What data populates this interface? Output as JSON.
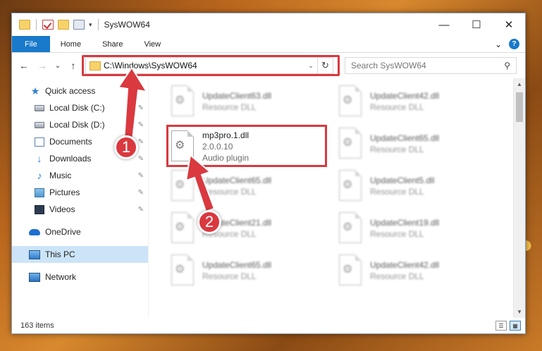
{
  "window": {
    "title": "SysWOW64",
    "controls": {
      "minimize": "—",
      "maximize": "☐",
      "close": "✕"
    }
  },
  "ribbon": {
    "tabs": [
      "File",
      "Home",
      "Share",
      "View"
    ],
    "expand_icon": "⌄",
    "help_icon": "?"
  },
  "nav": {
    "back": "←",
    "forward": "→",
    "recent": "⌄",
    "up": "↑",
    "address": "C:\\Windows\\SysWOW64",
    "address_dropdown": "⌄",
    "refresh": "↻",
    "search_placeholder": "Search SysWOW64",
    "search_icon": "⚲"
  },
  "sidebar": {
    "items": [
      {
        "label": "Quick access",
        "icon": "star-icon"
      },
      {
        "label": "Local Disk (C:)",
        "icon": "disk-icon",
        "pinned": true
      },
      {
        "label": "Local Disk (D:)",
        "icon": "disk-icon",
        "pinned": true
      },
      {
        "label": "Documents",
        "icon": "documents-icon",
        "pinned": true
      },
      {
        "label": "Downloads",
        "icon": "downloads-icon",
        "pinned": true
      },
      {
        "label": "Music",
        "icon": "music-icon",
        "pinned": true
      },
      {
        "label": "Pictures",
        "icon": "pictures-icon",
        "pinned": true
      },
      {
        "label": "Videos",
        "icon": "videos-icon",
        "pinned": true
      },
      {
        "label": "OneDrive",
        "icon": "onedrive-icon"
      },
      {
        "label": "This PC",
        "icon": "this-pc-icon",
        "selected": true
      },
      {
        "label": "Network",
        "icon": "network-icon"
      }
    ],
    "pin_glyph": "📌"
  },
  "files": {
    "left_column": [
      {
        "name": "UpdateClient63.dll",
        "type": "Resource DLL"
      },
      {
        "name": "mp3pro.1.dll",
        "version": "2.0.0.10",
        "type": "Audio plugin",
        "highlighted": true
      },
      {
        "name": "UpdateClient65.dll",
        "type": "Resource DLL"
      },
      {
        "name": "UpdateClient21.dll",
        "type": "Resource DLL"
      },
      {
        "name": "UpdateClient65.dll",
        "type": "Resource DLL"
      }
    ],
    "right_column": [
      {
        "name": "UpdateClient42.dll",
        "type": "Resource DLL"
      },
      {
        "name": "UpdateClient65.dll",
        "type": "Resource DLL"
      },
      {
        "name": "UpdateClient5.dll",
        "type": "Resource DLL"
      },
      {
        "name": "UpdateClient19.dll",
        "type": "Resource DLL"
      },
      {
        "name": "UpdateClient42.dll",
        "type": "Resource DLL"
      }
    ]
  },
  "status": {
    "item_count": "163 items"
  },
  "annotations": {
    "callout_1": "1",
    "callout_2": "2",
    "highlight_color": "#d9393f"
  },
  "colors": {
    "accent": "#1979ca",
    "selection": "#cce4f7"
  }
}
